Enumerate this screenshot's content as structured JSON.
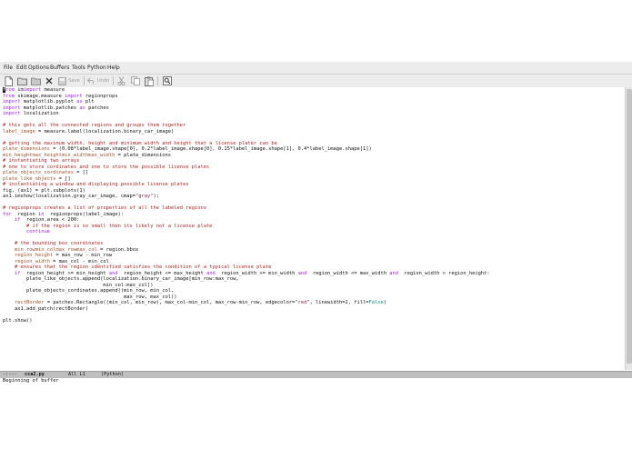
{
  "menu": [
    "File",
    "Edit",
    "Options",
    "Buffers",
    "Tools",
    "Python",
    "Help"
  ],
  "toolbar": {
    "save_label": "Save",
    "undo_label": "Undo",
    "icons": [
      "new-file-icon",
      "open-folder-icon",
      "dired-icon",
      "close-icon",
      "save-icon",
      "undo-icon",
      "cut-icon",
      "copy-icon",
      "paste-icon",
      "search-icon"
    ]
  },
  "colors": {
    "keyword": "#a020f0",
    "comment": "#b22222",
    "variable": "#a0522d",
    "string": "#8b2252",
    "constant": "#008b8b"
  },
  "code": [
    [
      [
        "kw",
        "from"
      ],
      [
        "",
        "im"
      ],
      [
        "kw",
        "import"
      ],
      [
        "",
        "measure"
      ]
    ],
    [
      [
        "kw",
        "from"
      ],
      [
        "",
        "skimage.measure "
      ],
      [
        "kw",
        "import"
      ],
      [
        "",
        "regionprops"
      ]
    ],
    [
      [
        "kw",
        "import"
      ],
      [
        "",
        "matplotlib.pyplot "
      ],
      [
        "kw",
        "as"
      ],
      [
        "",
        "plt"
      ]
    ],
    [
      [
        "kw",
        "import"
      ],
      [
        "",
        "matplotlib.patches "
      ],
      [
        "kw",
        "as"
      ],
      [
        "",
        "patches"
      ]
    ],
    [
      [
        "kw",
        "import"
      ],
      [
        "",
        "localization"
      ]
    ],
    [
      [
        "",
        ""
      ]
    ],
    [
      [
        "cm",
        "# this gets all the connected regions and groups them together"
      ]
    ],
    [
      [
        "vn",
        "label_image"
      ],
      [
        "",
        " = measure.label(localization.binary_car_image)"
      ]
    ],
    [
      [
        "",
        ""
      ]
    ],
    [
      [
        "cm",
        "# getting the maximum width, height and minimum width and height that a license plater can be"
      ]
    ],
    [
      [
        "vn",
        "plate_dimensions"
      ],
      [
        "",
        " = (0.08*label_image.shape[0], 0.2*label_image.shape[0], 0.15*label_image.shape[1], 0.4*label_image.shape[1])"
      ]
    ],
    [
      [
        "vn",
        "min_height"
      ],
      [
        ", "
      ],
      [
        "vn",
        "max_height"
      ],
      [
        ", "
      ],
      [
        "vn",
        "min_width"
      ],
      [
        ", "
      ],
      [
        "vn",
        "max_width"
      ],
      [
        "",
        " = plate_dimensions"
      ]
    ],
    [
      [
        "cm",
        "# instantiating two arrays"
      ]
    ],
    [
      [
        "cm",
        "# one to store cordinates and one to store the possible license plates"
      ]
    ],
    [
      [
        "vn",
        "plate_objects_cordinates"
      ],
      [
        "",
        " = []"
      ]
    ],
    [
      [
        "vn",
        "plate_like_objects"
      ],
      [
        "",
        " = []"
      ]
    ],
    [
      [
        "cm",
        "# instantiating a window and displaying possible license plates"
      ]
    ],
    [
      [
        "",
        "fig, (ax1) = plt.subplots(1)"
      ]
    ],
    [
      [
        "",
        "ax1.imshow(localization.gray_car_image, cmap="
      ],
      [
        "st",
        "\"gray\""
      ],
      [
        "",
        ");"
      ]
    ],
    [
      [
        "",
        ""
      ]
    ],
    [
      [
        "cm",
        "# regionprops creates a list of properties of all the labeled regions"
      ]
    ],
    [
      [
        "kw",
        "for"
      ],
      [
        "",
        " region "
      ],
      [
        "kw",
        "in"
      ],
      [
        "",
        " regionprops(label_image):"
      ]
    ],
    [
      [
        "",
        "    "
      ],
      [
        "kw",
        "if"
      ],
      [
        "",
        " region.area < 200:"
      ]
    ],
    [
      [
        "",
        "        "
      ],
      [
        "cm",
        "# if the region is so small then its likely not a license plate"
      ]
    ],
    [
      [
        "",
        "        "
      ],
      [
        "kw",
        "continue"
      ]
    ],
    [
      [
        "",
        ""
      ]
    ],
    [
      [
        "",
        "    "
      ],
      [
        "cm",
        "# the bounding box coordinates"
      ]
    ],
    [
      [
        "",
        "    "
      ],
      [
        "vn",
        "min_row"
      ],
      [
        ", "
      ],
      [
        "vn",
        "min_col"
      ],
      [
        ", "
      ],
      [
        "vn",
        "max_row"
      ],
      [
        ", "
      ],
      [
        "vn",
        "max_col"
      ],
      [
        "",
        " = region.bbox"
      ]
    ],
    [
      [
        "",
        "    "
      ],
      [
        "vn",
        "region_height"
      ],
      [
        "",
        " = max_row - min_row"
      ]
    ],
    [
      [
        "",
        "    "
      ],
      [
        "vn",
        "region_width"
      ],
      [
        "",
        " = max_col - min_col"
      ]
    ],
    [
      [
        "",
        "    "
      ],
      [
        "cm",
        "# ensures that the region identified satisfies the condition of a typical license plate"
      ]
    ],
    [
      [
        "",
        "    "
      ],
      [
        "kw",
        "if"
      ],
      [
        "",
        " region_height >= min_height "
      ],
      [
        "kw",
        "and"
      ],
      [
        "",
        " region_height <= max_height "
      ],
      [
        "kw",
        "and"
      ],
      [
        "",
        " region_width >= min_width "
      ],
      [
        "kw",
        "and"
      ],
      [
        "",
        " region_width <= max_width "
      ],
      [
        "kw",
        "and"
      ],
      [
        "",
        " region_width > region_height:"
      ]
    ],
    [
      [
        "",
        "        plate_like_objects.append(localization.binary_car_image[min_row:max_row,"
      ]
    ],
    [
      [
        "",
        "                                  min_col:max_col])"
      ]
    ],
    [
      [
        "",
        "        plate_objects_cordinates.append((min_row, min_col,"
      ]
    ],
    [
      [
        "",
        "                                         max_row, max_col))"
      ]
    ],
    [
      [
        "",
        "    "
      ],
      [
        "vn",
        "rectBorder"
      ],
      [
        "",
        " = patches.Rectangle((min_col, min_row), max_col-min_col, max_row-min_row, edgecolor="
      ],
      [
        "st",
        "\"red\""
      ],
      [
        "",
        ", linewidth=2, fill="
      ],
      [
        "ct",
        "False"
      ],
      [
        "",
        ")"
      ]
    ],
    [
      [
        "",
        "    ax1.add_patch(rectBorder)"
      ]
    ],
    [
      [
        "",
        ""
      ]
    ],
    [
      [
        "",
        "plt.show()"
      ]
    ]
  ],
  "modeline": {
    "status": "-:---",
    "buffer": "cca2.py",
    "position": "All L1",
    "mode": "(Python)"
  },
  "minibuffer": "Beginning of buffer"
}
